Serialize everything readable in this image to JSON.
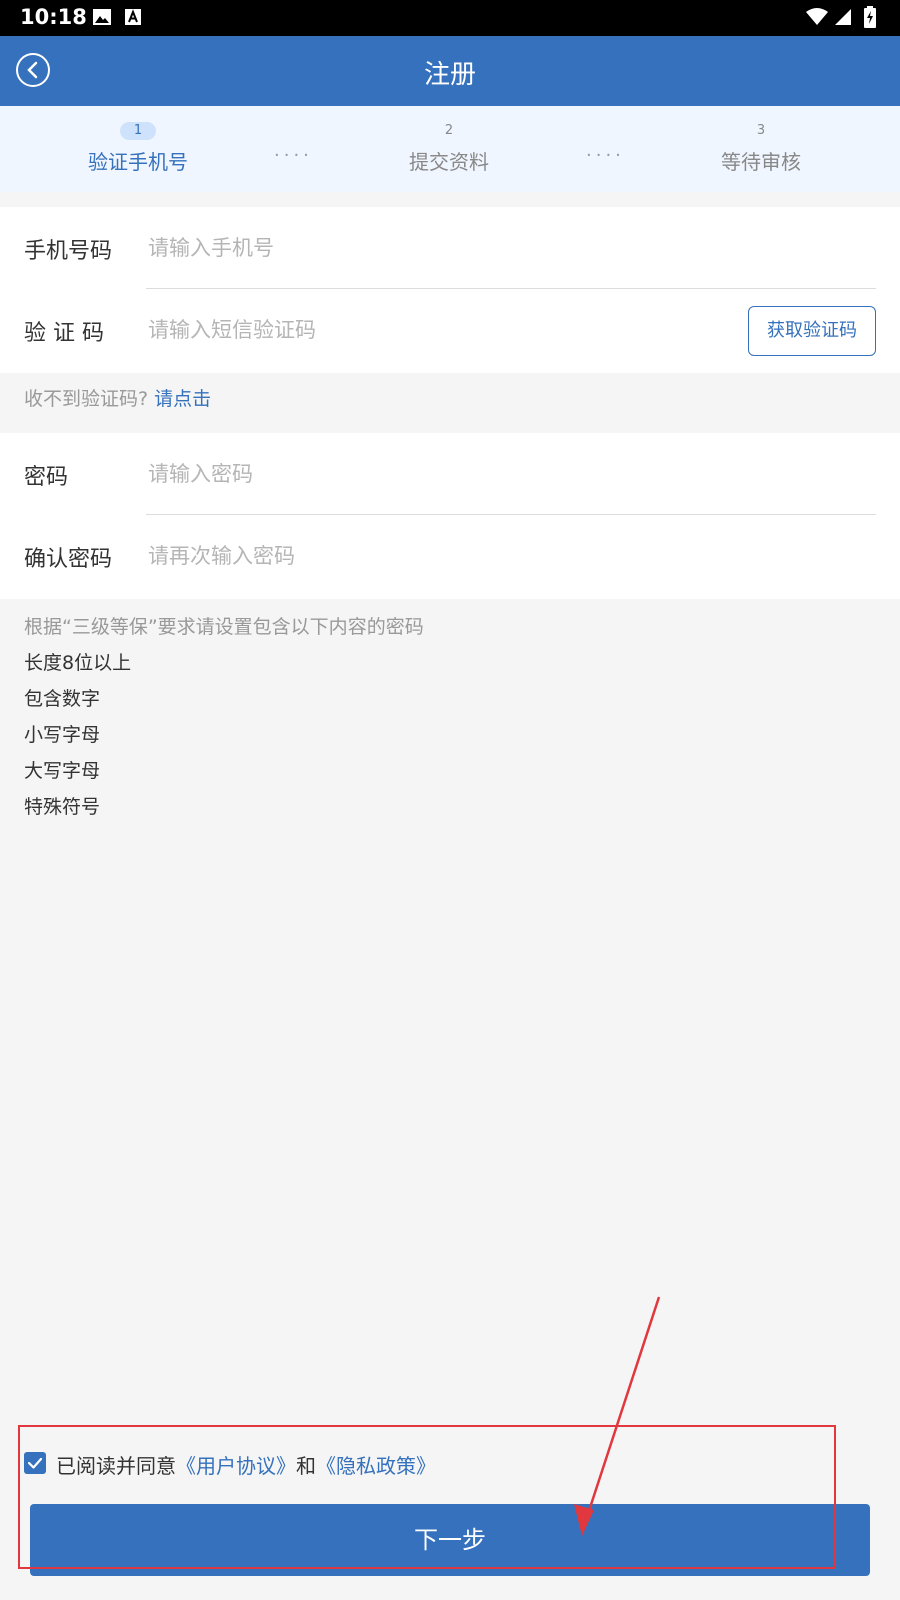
{
  "status_bar": {
    "time": "10:18"
  },
  "header": {
    "title": "注册"
  },
  "steps": [
    {
      "number": "1",
      "label": "验证手机号",
      "active": true
    },
    {
      "number": "2",
      "label": "提交资料",
      "active": false
    },
    {
      "number": "3",
      "label": "等待审核",
      "active": false
    }
  ],
  "step_separator": "····",
  "form": {
    "phone": {
      "label": "手机号码",
      "placeholder": "请输入手机号",
      "value": ""
    },
    "code": {
      "label": "验 证 码",
      "placeholder": "请输入短信验证码",
      "value": "",
      "button": "获取验证码"
    },
    "code_hint": {
      "text": "收不到验证码?",
      "link": "请点击"
    },
    "password": {
      "label": "密码",
      "placeholder": "请输入密码",
      "value": ""
    },
    "confirm_password": {
      "label": "确认密码",
      "placeholder": "请再次输入密码",
      "value": ""
    }
  },
  "password_rules": {
    "intro": "根据“三级等保”要求请设置包含以下内容的密码",
    "items": [
      "长度8位以上",
      "包含数字",
      "小写字母",
      "大写字母",
      "特殊符号"
    ]
  },
  "agreement": {
    "checked": true,
    "prefix": "已阅读并同意",
    "user_agreement": "《用户协议》",
    "and": "和",
    "privacy_policy": "《隐私政策》"
  },
  "next_button": "下一步",
  "colors": {
    "primary": "#3571bc",
    "annotation": "#e0383e"
  }
}
